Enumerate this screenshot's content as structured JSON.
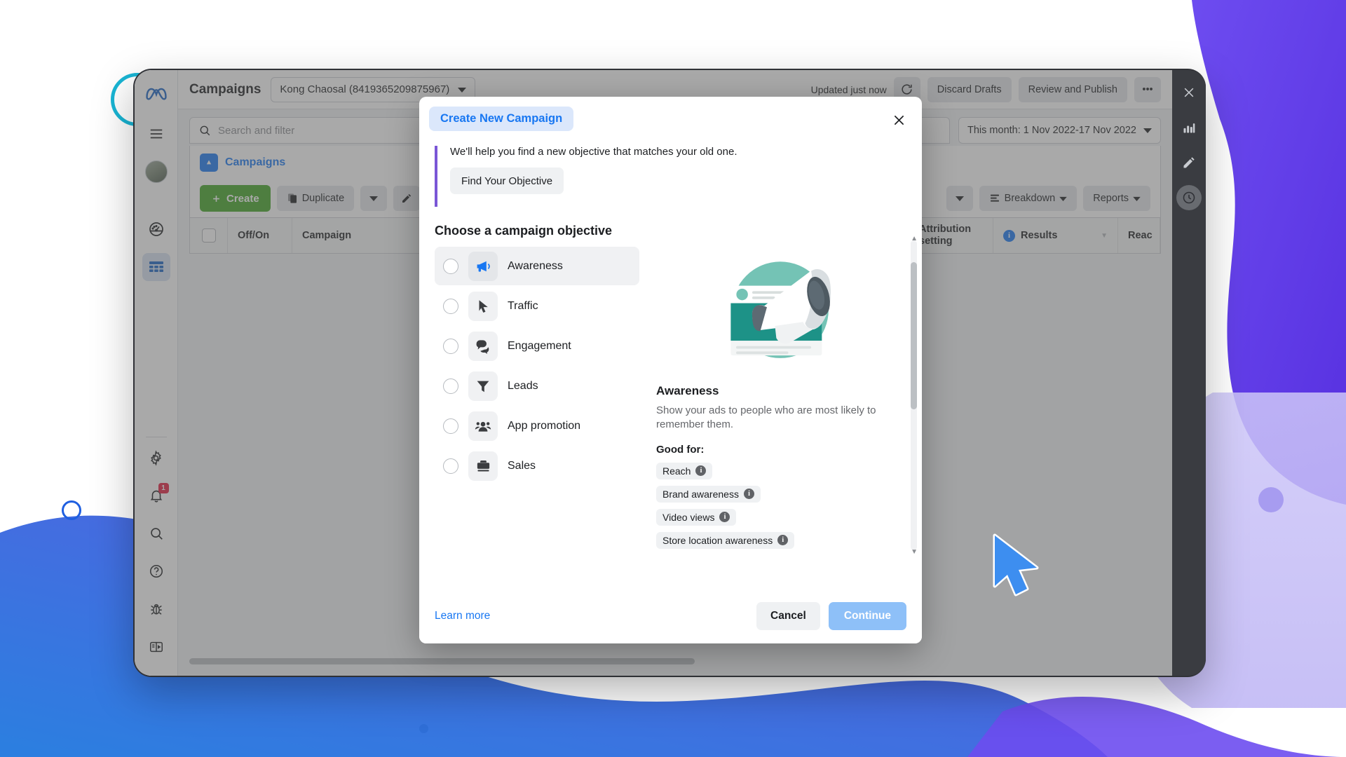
{
  "app": {
    "topbar": {
      "page_title": "Campaigns",
      "account_selector": "Kong Chaosal (8419365209875967)",
      "updated_text": "Updated just now",
      "refresh_icon": "refresh-icon",
      "discard_drafts": "Discard Drafts",
      "review_publish": "Review and Publish",
      "more_menu": "•••"
    },
    "search": {
      "placeholder": "Search and filter",
      "icon": "search-icon"
    },
    "date_range": "This month: 1 Nov 2022-17 Nov 2022",
    "breadcrumb": {
      "label": "Campaigns",
      "icon": "campaign-folder-icon"
    },
    "toolbar": {
      "create": "Create",
      "duplicate": "Duplicate",
      "breakdown": "Breakdown",
      "reports": "Reports"
    },
    "table": {
      "columns": [
        {
          "id": "checkbox",
          "label": ""
        },
        {
          "id": "offon",
          "label": "Off/On"
        },
        {
          "id": "campaign",
          "label": "Campaign"
        },
        {
          "id": "attribution",
          "label": "Attribution setting"
        },
        {
          "id": "results",
          "label": "Results"
        },
        {
          "id": "reach",
          "label": "Reac"
        }
      ]
    },
    "rail": {
      "logo": "meta-logo-icon",
      "items": [
        {
          "name": "menu-icon",
          "label": "Menu"
        },
        {
          "name": "avatar",
          "label": "Profile"
        },
        {
          "name": "gauge-icon",
          "label": "Performance"
        },
        {
          "name": "table-icon",
          "label": "Campaigns"
        }
      ],
      "bottom_items": [
        {
          "name": "gear-icon",
          "label": "Settings",
          "badge": ""
        },
        {
          "name": "bell-icon",
          "label": "Notifications",
          "badge": "1"
        },
        {
          "name": "search-icon",
          "label": "Search",
          "badge": ""
        },
        {
          "name": "help-icon",
          "label": "Help",
          "badge": ""
        },
        {
          "name": "bug-icon",
          "label": "Report a bug",
          "badge": ""
        },
        {
          "name": "panel-icon",
          "label": "Toggle panel",
          "badge": ""
        }
      ]
    },
    "dark_rail": {
      "items": [
        {
          "name": "close-icon"
        },
        {
          "name": "bar-chart-icon"
        },
        {
          "name": "pencil-icon"
        },
        {
          "name": "clock-icon"
        }
      ]
    }
  },
  "modal": {
    "chip_title": "Create New Campaign",
    "close_icon": "close-icon",
    "notice": {
      "text": "We'll help you find a new objective that matches your old one.",
      "button": "Find Your Objective"
    },
    "section_title": "Choose a campaign objective",
    "objectives": [
      {
        "label": "Awareness",
        "icon": "megaphone-icon",
        "selected": true
      },
      {
        "label": "Traffic",
        "icon": "cursor-arrow-icon",
        "selected": false
      },
      {
        "label": "Engagement",
        "icon": "chat-bubbles-icon",
        "selected": false
      },
      {
        "label": "Leads",
        "icon": "funnel-icon",
        "selected": false
      },
      {
        "label": "App promotion",
        "icon": "people-icon",
        "selected": false
      },
      {
        "label": "Sales",
        "icon": "briefcase-icon",
        "selected": false
      }
    ],
    "detail": {
      "illustration": "megaphone-illustration",
      "title": "Awareness",
      "description": "Show your ads to people who are most likely to remember them.",
      "good_for_label": "Good for:",
      "tags": [
        "Reach",
        "Brand awareness",
        "Video views",
        "Store location awareness"
      ]
    },
    "footer": {
      "learn_more": "Learn more",
      "cancel": "Cancel",
      "continue": "Continue"
    }
  },
  "colors": {
    "brand_blue": "#1877f2",
    "create_green": "#42a524",
    "accent_purple": "#7a56d6",
    "badge_red": "#e41e3f",
    "illustration_teal": "#74c3b5"
  }
}
